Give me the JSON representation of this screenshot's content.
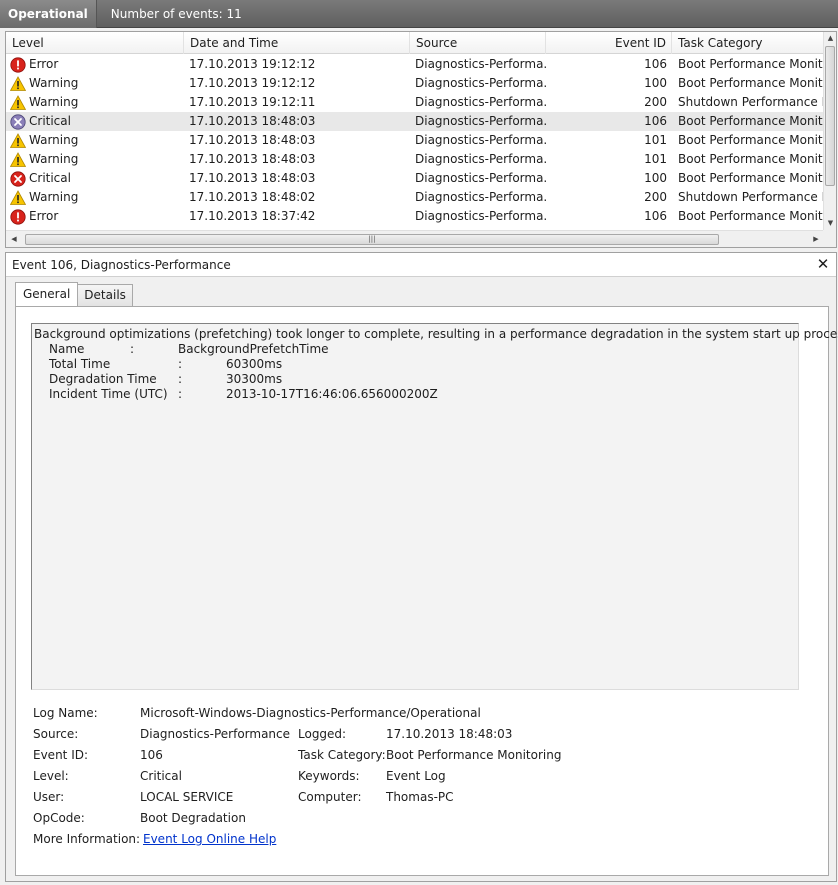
{
  "header": {
    "tab_label": "Operational",
    "event_count": "Number of events: 11"
  },
  "columns": {
    "level": "Level",
    "date": "Date and Time",
    "source": "Source",
    "event_id": "Event ID",
    "task": "Task Category"
  },
  "events": [
    {
      "level": "Error",
      "icon": "error-icon",
      "date": "17.10.2013 19:12:12",
      "source": "Diagnostics-Performa...",
      "event_id": "106",
      "task": "Boot Performance Monitor"
    },
    {
      "level": "Warning",
      "icon": "warning-icon",
      "date": "17.10.2013 19:12:12",
      "source": "Diagnostics-Performa...",
      "event_id": "100",
      "task": "Boot Performance Monitor"
    },
    {
      "level": "Warning",
      "icon": "warning-icon",
      "date": "17.10.2013 19:12:11",
      "source": "Diagnostics-Performa...",
      "event_id": "200",
      "task": "Shutdown Performance Mc"
    },
    {
      "level": "Critical",
      "icon": "critical-icon",
      "date": "17.10.2013 18:48:03",
      "source": "Diagnostics-Performa...",
      "event_id": "106",
      "task": "Boot Performance Monitor",
      "selected": true
    },
    {
      "level": "Warning",
      "icon": "warning-icon",
      "date": "17.10.2013 18:48:03",
      "source": "Diagnostics-Performa...",
      "event_id": "101",
      "task": "Boot Performance Monitor"
    },
    {
      "level": "Warning",
      "icon": "warning-icon",
      "date": "17.10.2013 18:48:03",
      "source": "Diagnostics-Performa...",
      "event_id": "101",
      "task": "Boot Performance Monitor"
    },
    {
      "level": "Critical",
      "icon": "critical-error-icon",
      "date": "17.10.2013 18:48:03",
      "source": "Diagnostics-Performa...",
      "event_id": "100",
      "task": "Boot Performance Monitor"
    },
    {
      "level": "Warning",
      "icon": "warning-icon",
      "date": "17.10.2013 18:48:02",
      "source": "Diagnostics-Performa...",
      "event_id": "200",
      "task": "Shutdown Performance Mc"
    },
    {
      "level": "Error",
      "icon": "error-icon",
      "date": "17.10.2013 18:37:42",
      "source": "Diagnostics-Performa...",
      "event_id": "106",
      "task": "Boot Performance Monitor"
    }
  ],
  "detail": {
    "title": "Event 106, Diagnostics-Performance",
    "tabs": {
      "general": "General",
      "details": "Details"
    },
    "description": {
      "intro": "Background optimizations (prefetching) took longer to complete, resulting in a performance degradation in the system start up process:",
      "fields": [
        {
          "key": "Name",
          "sep": ":",
          "value": "BackgroundPrefetchTime"
        },
        {
          "key": "Total Time",
          "sep": ":",
          "value": "60300ms"
        },
        {
          "key": "Degradation Time",
          "sep": ":",
          "value": "30300ms"
        },
        {
          "key": "Incident Time (UTC)",
          "sep": ":",
          "value": "2013-10-17T16:46:06.656000200Z"
        }
      ]
    },
    "props": {
      "log_name_label": "Log Name:",
      "log_name": "Microsoft-Windows-Diagnostics-Performance/Operational",
      "source_label": "Source:",
      "source": "Diagnostics-Performance",
      "logged_label": "Logged:",
      "logged": "17.10.2013 18:48:03",
      "event_id_label": "Event ID:",
      "event_id": "106",
      "task_label": "Task Category:",
      "task": "Boot Performance Monitoring",
      "level_label": "Level:",
      "level": "Critical",
      "keywords_label": "Keywords:",
      "keywords": "Event Log",
      "user_label": "User:",
      "user": "LOCAL SERVICE",
      "computer_label": "Computer:",
      "computer": "Thomas-PC",
      "opcode_label": "OpCode:",
      "opcode": "Boot Degradation",
      "more_info_label": "More Information:",
      "more_info_link": "Event Log Online Help"
    }
  },
  "colors": {
    "error": "#d8231c",
    "warning": "#f7c400",
    "critical": "#8a7fb8",
    "link": "#0033cc"
  }
}
